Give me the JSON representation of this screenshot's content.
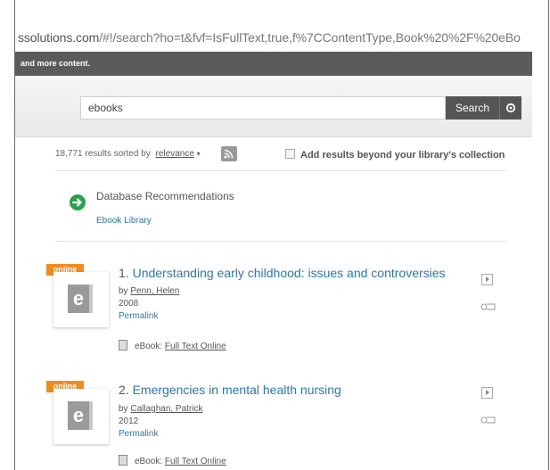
{
  "browser": {
    "url_prefix": "ssolutions.com",
    "url_rest": "/#!/search?ho=t&fvf=IsFullText,true,f%7CContentType,Book%20%2F%20eBo"
  },
  "banner": {
    "text": "and more content."
  },
  "search": {
    "value": "ebooks",
    "button_label": "Search"
  },
  "results_meta": {
    "count_text": "18,771 results sorted by",
    "sort_label": "relevance",
    "add_results_label": "Add results beyond your library's collection"
  },
  "recommendations": {
    "title": "Database Recommendations",
    "link": "Ebook Library"
  },
  "results": [
    {
      "badge": "online",
      "number": "1.",
      "title": "Understanding early childhood: issues and controversies",
      "by_label": "by",
      "author": "Penn, Helen",
      "year": "2008",
      "permalink": "Permalink",
      "format_label": "eBook:",
      "format_link": "Full Text Online"
    },
    {
      "badge": "online",
      "number": "2.",
      "title": "Emergencies in mental health nursing",
      "by_label": "by",
      "author": "Callaghan, Patrick",
      "year": "2012",
      "permalink": "Permalink",
      "format_label": "eBook:",
      "format_link": "Full Text Online"
    }
  ],
  "colors": {
    "accent": "#f28a1e",
    "link": "#2a7ab0",
    "banner": "#5b5b5b",
    "recommend_icon": "#2aa24a"
  },
  "icons": [
    "gear-icon",
    "rss-icon",
    "recommendation-arrow-icon",
    "ebook-cover-icon",
    "preview-icon",
    "tag-icon",
    "format-icon"
  ]
}
